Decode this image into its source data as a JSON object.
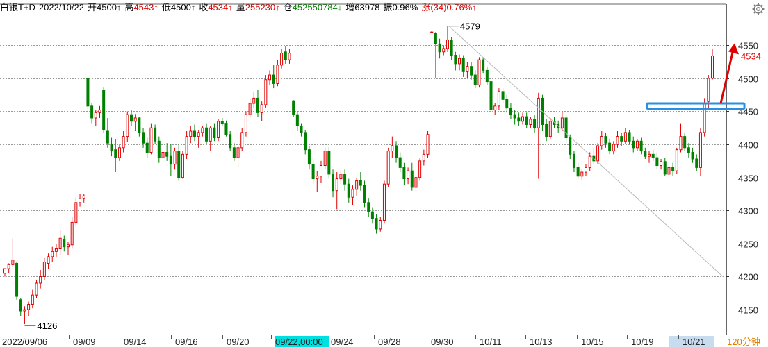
{
  "header": {
    "symbol": "白银T+D",
    "date": "2022/10/22",
    "open_label": "开",
    "open_value": "4500↑",
    "high_label": "高",
    "high_value": "4543↑",
    "low_label": "低",
    "low_value": "4500↑",
    "close_label": "收",
    "close_value": "4534↑",
    "volume_label": "量",
    "volume_value": "255230↑",
    "oi_label": "仓",
    "oi_value": "452550784↓",
    "oi_change_label": "增",
    "oi_change_value": "63978",
    "amplitude_label": "振",
    "amplitude_value": "0.96%",
    "change_label": "涨",
    "change_value": "(34)0.76%↑"
  },
  "period_label": "120分钟",
  "colors": {
    "up": "#e00000",
    "down": "#008000",
    "grid": "#9a9a9a",
    "highlight_box": "#2a8fe0",
    "arrow": "#e00000",
    "date_highlight": "#00e0e0",
    "last_date_highlight": "#c8dcf0"
  },
  "chart_data": {
    "type": "candlestick",
    "y_ticks": [
      4150,
      4200,
      4250,
      4300,
      4350,
      4400,
      4450,
      4500,
      4550
    ],
    "ylim": [
      4127,
      4587
    ],
    "x_tick_labels": [
      "2022/09/06",
      "09/09",
      "09/14",
      "09/16",
      "09/20",
      "09/22,00:00",
      "09/24",
      "09/28",
      "09/30",
      "10/11",
      "10/13",
      "10/15",
      "10/19",
      "10/21"
    ],
    "highlighted_x_label": "09/22,00:00",
    "annotations": [
      {
        "text": "4579",
        "value": 4579
      },
      {
        "text": "4126",
        "value": 4126
      }
    ],
    "last_price_label": "4534",
    "last_price": 4534,
    "resistance_box": {
      "value_low": 4454,
      "value_high": 4462
    },
    "trend_line": {
      "from_value": 4579,
      "to_value": 4200
    },
    "candles": [
      [
        4205,
        4212,
        4200,
        4212
      ],
      [
        4212,
        4220,
        4205,
        4218
      ],
      [
        4218,
        4258,
        4214,
        4225
      ],
      [
        4220,
        4222,
        4165,
        4170
      ],
      [
        4165,
        4168,
        4140,
        4148
      ],
      [
        4148,
        4155,
        4128,
        4150
      ],
      [
        4150,
        4162,
        4140,
        4158
      ],
      [
        4158,
        4180,
        4152,
        4172
      ],
      [
        4172,
        4195,
        4168,
        4190
      ],
      [
        4190,
        4210,
        4182,
        4200
      ],
      [
        4200,
        4228,
        4195,
        4222
      ],
      [
        4220,
        4235,
        4212,
        4230
      ],
      [
        4230,
        4245,
        4222,
        4238
      ],
      [
        4238,
        4250,
        4230,
        4242
      ],
      [
        4242,
        4270,
        4232,
        4258
      ],
      [
        4256,
        4262,
        4238,
        4245
      ],
      [
        4245,
        4252,
        4232,
        4248
      ],
      [
        4248,
        4290,
        4242,
        4282
      ],
      [
        4282,
        4320,
        4276,
        4312
      ],
      [
        4312,
        4325,
        4306,
        4318
      ],
      [
        4318,
        4325,
        4312,
        4322
      ],
      [
        4500,
        4500,
        4452,
        4458
      ],
      [
        4458,
        4462,
        4432,
        4440
      ],
      [
        4440,
        4452,
        4428,
        4448
      ],
      [
        4448,
        4458,
        4440,
        4452
      ],
      [
        4482,
        4486,
        4418,
        4422
      ],
      [
        4420,
        4440,
        4395,
        4402
      ],
      [
        4400,
        4410,
        4382,
        4390
      ],
      [
        4392,
        4408,
        4358,
        4380
      ],
      [
        4380,
        4400,
        4375,
        4395
      ],
      [
        4395,
        4420,
        4388,
        4412
      ],
      [
        4412,
        4450,
        4404,
        4445
      ],
      [
        4445,
        4452,
        4428,
        4435
      ],
      [
        4435,
        4446,
        4420,
        4440
      ],
      [
        4440,
        4442,
        4412,
        4418
      ],
      [
        4418,
        4425,
        4395,
        4402
      ],
      [
        4402,
        4410,
        4380,
        4388
      ],
      [
        4388,
        4432,
        4385,
        4425
      ],
      [
        4425,
        4430,
        4400,
        4405
      ],
      [
        4405,
        4412,
        4372,
        4380
      ],
      [
        4380,
        4395,
        4362,
        4388
      ],
      [
        4388,
        4402,
        4375,
        4382
      ],
      [
        4382,
        4400,
        4352,
        4370
      ],
      [
        4370,
        4395,
        4362,
        4390
      ],
      [
        4390,
        4400,
        4345,
        4350
      ],
      [
        4350,
        4390,
        4348,
        4385
      ],
      [
        4385,
        4420,
        4378,
        4412
      ],
      [
        4412,
        4428,
        4402,
        4420
      ],
      [
        4420,
        4430,
        4405,
        4412
      ],
      [
        4412,
        4422,
        4395,
        4418
      ],
      [
        4418,
        4428,
        4412,
        4425
      ],
      [
        4425,
        4432,
        4400,
        4405
      ],
      [
        4405,
        4428,
        4390,
        4425
      ],
      [
        4425,
        4432,
        4405,
        4410
      ],
      [
        4410,
        4438,
        4405,
        4435
      ],
      [
        4435,
        4440,
        4428,
        4432
      ],
      [
        4432,
        4436,
        4412,
        4415
      ],
      [
        4415,
        4420,
        4390,
        4395
      ],
      [
        4395,
        4402,
        4375,
        4380
      ],
      [
        4380,
        4398,
        4365,
        4395
      ],
      [
        4395,
        4425,
        4390,
        4418
      ],
      [
        4418,
        4450,
        4412,
        4445
      ],
      [
        4445,
        4470,
        4440,
        4462
      ],
      [
        4462,
        4480,
        4455,
        4470
      ],
      [
        4470,
        4482,
        4442,
        4448
      ],
      [
        4448,
        4465,
        4435,
        4460
      ],
      [
        4460,
        4505,
        4455,
        4498
      ],
      [
        4498,
        4512,
        4490,
        4505
      ],
      [
        4505,
        4520,
        4485,
        4492
      ],
      [
        4492,
        4528,
        4488,
        4520
      ],
      [
        4520,
        4545,
        4515,
        4538
      ],
      [
        4540,
        4548,
        4522,
        4528
      ],
      [
        4528,
        4545,
        4522,
        4538
      ],
      [
        4466,
        4467,
        4442,
        4445
      ],
      [
        4445,
        4450,
        4420,
        4428
      ],
      [
        4428,
        4432,
        4412,
        4418
      ],
      [
        4418,
        4422,
        4385,
        4392
      ],
      [
        4392,
        4398,
        4362,
        4370
      ],
      [
        4370,
        4378,
        4340,
        4348
      ],
      [
        4348,
        4360,
        4328,
        4352
      ],
      [
        4352,
        4375,
        4342,
        4368
      ],
      [
        4368,
        4395,
        4362,
        4390
      ],
      [
        4390,
        4396,
        4348,
        4355
      ],
      [
        4355,
        4362,
        4320,
        4330
      ],
      [
        4330,
        4358,
        4302,
        4348
      ],
      [
        4348,
        4360,
        4340,
        4355
      ],
      [
        4355,
        4362,
        4330,
        4340
      ],
      [
        4340,
        4348,
        4312,
        4320
      ],
      [
        4320,
        4338,
        4308,
        4332
      ],
      [
        4332,
        4350,
        4322,
        4345
      ],
      [
        4345,
        4358,
        4330,
        4338
      ],
      [
        4338,
        4345,
        4305,
        4312
      ],
      [
        4312,
        4318,
        4290,
        4298
      ],
      [
        4298,
        4305,
        4280,
        4288
      ],
      [
        4288,
        4295,
        4265,
        4272
      ],
      [
        4272,
        4290,
        4268,
        4285
      ],
      [
        4285,
        4345,
        4280,
        4340
      ],
      [
        4340,
        4395,
        4335,
        4390
      ],
      [
        4390,
        4412,
        4380,
        4398
      ],
      [
        4398,
        4405,
        4372,
        4380
      ],
      [
        4380,
        4388,
        4358,
        4365
      ],
      [
        4365,
        4372,
        4338,
        4348
      ],
      [
        4348,
        4365,
        4340,
        4360
      ],
      [
        4360,
        4372,
        4330,
        4335
      ],
      [
        4335,
        4355,
        4328,
        4350
      ],
      [
        4350,
        4380,
        4345,
        4375
      ],
      [
        4375,
        4392,
        4368,
        4385
      ],
      [
        4385,
        4420,
        4380,
        4415
      ],
      [
        4570,
        4572,
        4568,
        4570
      ],
      [
        4568,
        4570,
        4500,
        4552
      ],
      [
        4552,
        4560,
        4530,
        4540
      ],
      [
        4540,
        4550,
        4535,
        4545
      ],
      [
        4545,
        4579,
        4540,
        4558
      ],
      [
        4558,
        4562,
        4528,
        4535
      ],
      [
        4535,
        4540,
        4512,
        4522
      ],
      [
        4522,
        4536,
        4512,
        4530
      ],
      [
        4530,
        4535,
        4502,
        4510
      ],
      [
        4510,
        4525,
        4500,
        4518
      ],
      [
        4518,
        4524,
        4498,
        4505
      ],
      [
        4505,
        4512,
        4485,
        4490
      ],
      [
        4490,
        4532,
        4486,
        4528
      ],
      [
        4528,
        4532,
        4508,
        4512
      ],
      [
        4512,
        4518,
        4490,
        4495
      ],
      [
        4495,
        4500,
        4448,
        4452
      ],
      [
        4452,
        4462,
        4445,
        4458
      ],
      [
        4458,
        4485,
        4452,
        4480
      ],
      [
        4480,
        4485,
        4462,
        4468
      ],
      [
        4468,
        4475,
        4448,
        4455
      ],
      [
        4455,
        4462,
        4438,
        4445
      ],
      [
        4445,
        4452,
        4430,
        4440
      ],
      [
        4440,
        4448,
        4428,
        4435
      ],
      [
        4435,
        4448,
        4430,
        4442
      ],
      [
        4442,
        4448,
        4425,
        4430
      ],
      [
        4430,
        4442,
        4425,
        4438
      ],
      [
        4438,
        4445,
        4418,
        4425
      ],
      [
        4425,
        4478,
        4348,
        4470
      ],
      [
        4470,
        4475,
        4420,
        4430
      ],
      [
        4430,
        4438,
        4405,
        4412
      ],
      [
        4412,
        4440,
        4408,
        4435
      ],
      [
        4435,
        4442,
        4425,
        4430
      ],
      [
        4430,
        4436,
        4418,
        4425
      ],
      [
        4425,
        4450,
        4420,
        4440
      ],
      [
        4440,
        4445,
        4402,
        4410
      ],
      [
        4410,
        4415,
        4378,
        4385
      ],
      [
        4385,
        4390,
        4358,
        4365
      ],
      [
        4365,
        4372,
        4348,
        4352
      ],
      [
        4352,
        4362,
        4346,
        4358
      ],
      [
        4358,
        4370,
        4352,
        4365
      ],
      [
        4365,
        4388,
        4360,
        4382
      ],
      [
        4382,
        4395,
        4370,
        4375
      ],
      [
        4375,
        4402,
        4370,
        4398
      ],
      [
        4398,
        4420,
        4392,
        4412
      ],
      [
        4412,
        4418,
        4395,
        4402
      ],
      [
        4402,
        4408,
        4385,
        4390
      ],
      [
        4390,
        4405,
        4385,
        4400
      ],
      [
        4400,
        4420,
        4395,
        4412
      ],
      [
        4412,
        4418,
        4398,
        4405
      ],
      [
        4405,
        4425,
        4400,
        4418
      ],
      [
        4418,
        4422,
        4400,
        4405
      ],
      [
        4405,
        4412,
        4388,
        4395
      ],
      [
        4395,
        4408,
        4390,
        4405
      ],
      [
        4405,
        4410,
        4385,
        4390
      ],
      [
        4390,
        4395,
        4378,
        4382
      ],
      [
        4382,
        4390,
        4372,
        4385
      ],
      [
        4385,
        4392,
        4375,
        4380
      ],
      [
        4380,
        4388,
        4362,
        4368
      ],
      [
        4368,
        4378,
        4362,
        4374
      ],
      [
        4374,
        4380,
        4352,
        4355
      ],
      [
        4355,
        4368,
        4350,
        4365
      ],
      [
        4365,
        4372,
        4352,
        4360
      ],
      [
        4360,
        4395,
        4355,
        4392
      ],
      [
        4392,
        4432,
        4388,
        4412
      ],
      [
        4412,
        4418,
        4390,
        4395
      ],
      [
        4395,
        4402,
        4380,
        4388
      ],
      [
        4388,
        4395,
        4372,
        4378
      ],
      [
        4378,
        4385,
        4360,
        4365
      ],
      [
        4365,
        4425,
        4352,
        4418
      ],
      [
        4418,
        4470,
        4412,
        4462
      ],
      [
        4465,
        4505,
        4455,
        4500
      ],
      [
        4500,
        4545,
        4498,
        4534
      ]
    ]
  }
}
